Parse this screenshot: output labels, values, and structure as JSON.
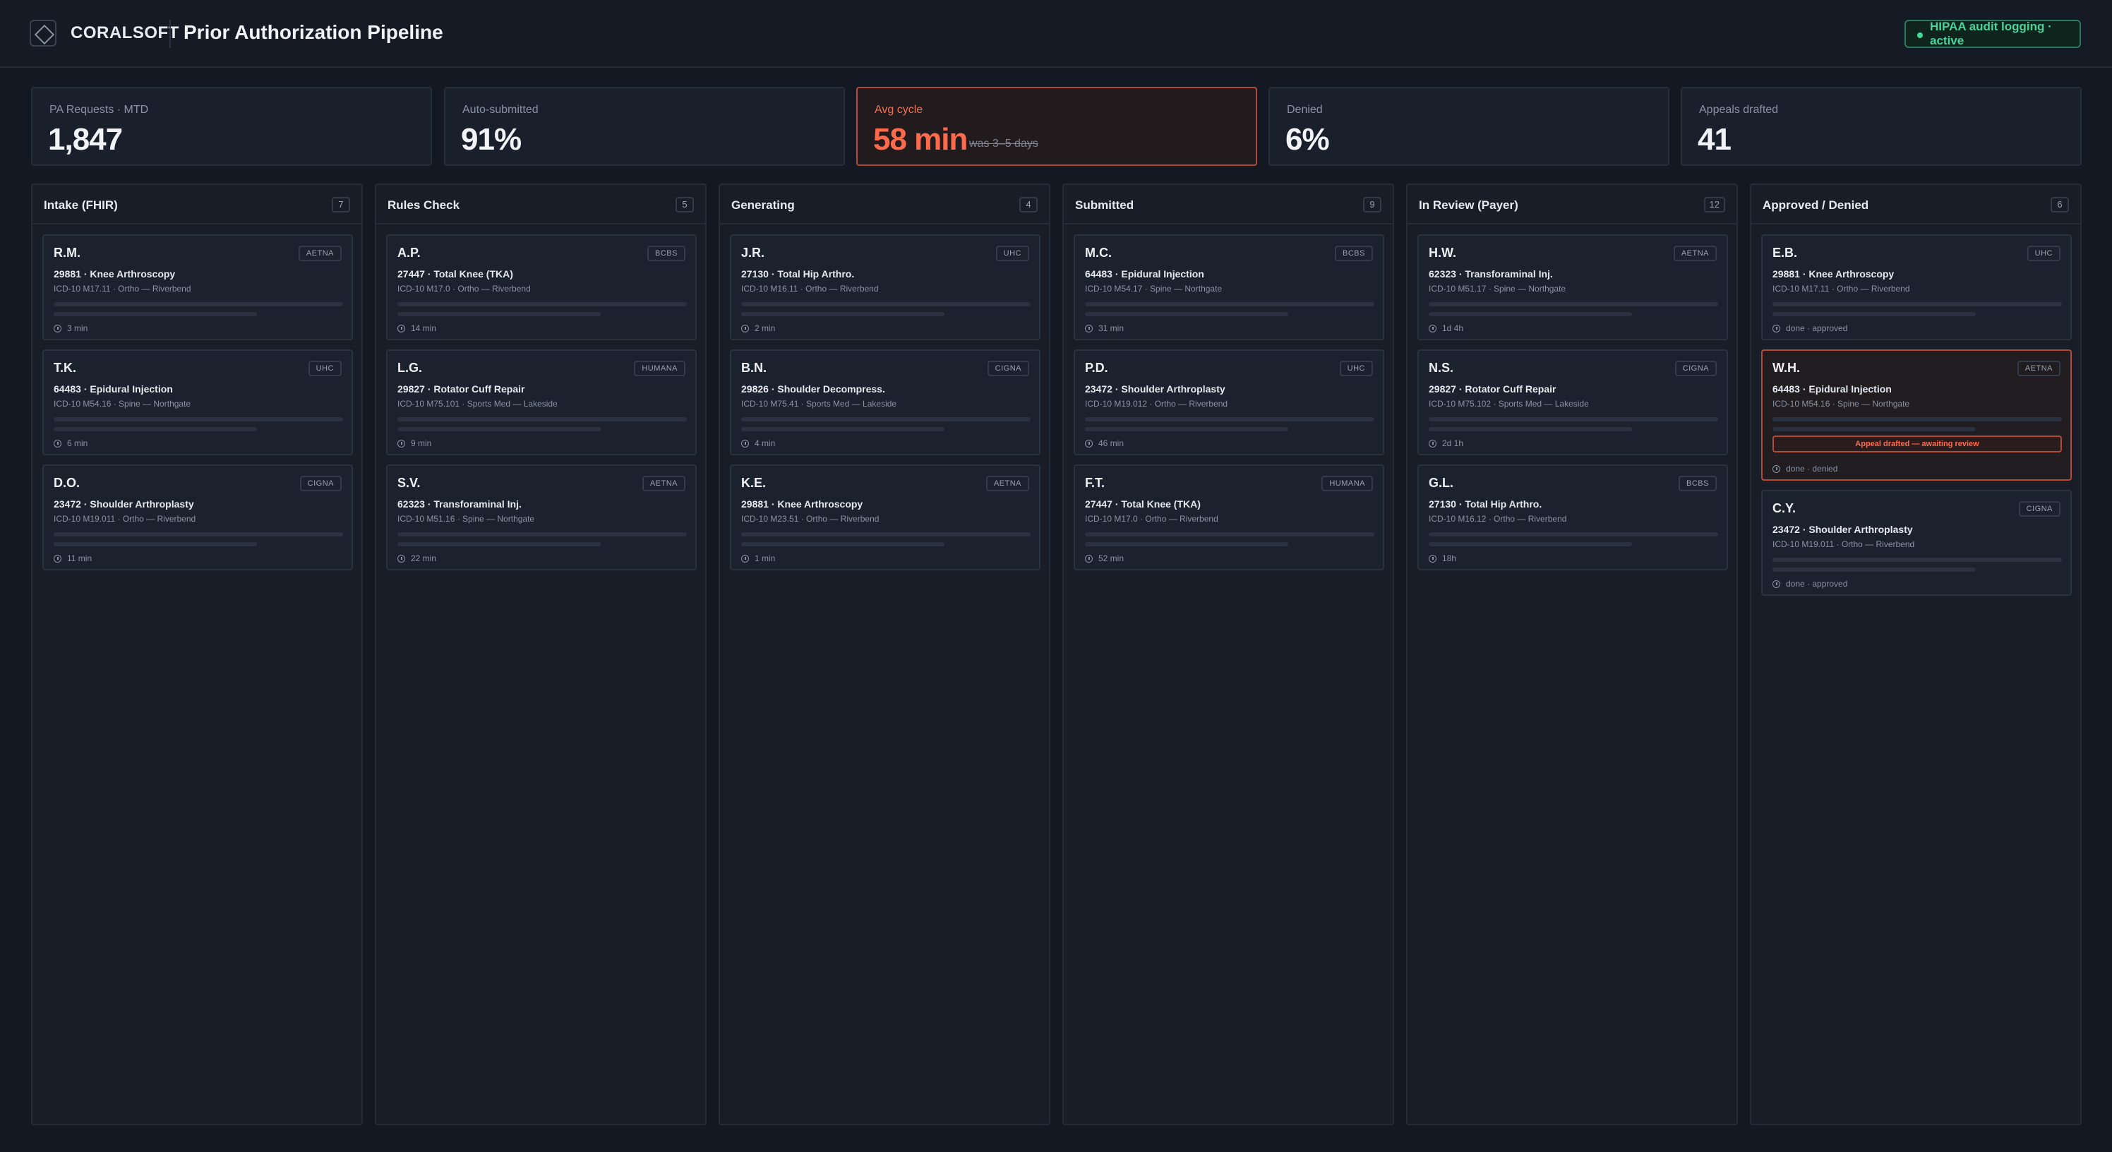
{
  "header": {
    "brand": "CORALSOFT",
    "title": "Prior Authorization Pipeline",
    "audit_status": "HIPAA audit logging · active"
  },
  "kpis": [
    {
      "label": "PA Requests · MTD",
      "value": "1,847"
    },
    {
      "label": "Auto-submitted",
      "value": "91%"
    },
    {
      "label": "Avg cycle",
      "value": "58 min",
      "sub": "was 3–5 days"
    },
    {
      "label": "Denied",
      "value": "6%"
    },
    {
      "label": "Appeals drafted",
      "value": "41"
    }
  ],
  "columns": [
    {
      "title": "Intake (FHIR)",
      "count": "7",
      "cards": [
        {
          "initials": "R.M.",
          "payer": "AETNA",
          "procedure": "29881 · Knee Arthroscopy",
          "dx": "ICD-10 M17.11 · Ortho — Riverbend",
          "time": "3 min"
        },
        {
          "initials": "T.K.",
          "payer": "UHC",
          "procedure": "64483 · Epidural Injection",
          "dx": "ICD-10 M54.16 · Spine — Northgate",
          "time": "6 min"
        },
        {
          "initials": "D.O.",
          "payer": "CIGNA",
          "procedure": "23472 · Shoulder Arthroplasty",
          "dx": "ICD-10 M19.011 · Ortho — Riverbend",
          "time": "11 min"
        }
      ]
    },
    {
      "title": "Rules Check",
      "count": "5",
      "cards": [
        {
          "initials": "A.P.",
          "payer": "BCBS",
          "procedure": "27447 · Total Knee (TKA)",
          "dx": "ICD-10 M17.0 · Ortho — Riverbend",
          "time": "14 min"
        },
        {
          "initials": "L.G.",
          "payer": "HUMANA",
          "procedure": "29827 · Rotator Cuff Repair",
          "dx": "ICD-10 M75.101 · Sports Med — Lakeside",
          "time": "9 min"
        },
        {
          "initials": "S.V.",
          "payer": "AETNA",
          "procedure": "62323 · Transforaminal Inj.",
          "dx": "ICD-10 M51.16 · Spine — Northgate",
          "time": "22 min"
        }
      ]
    },
    {
      "title": "Generating",
      "count": "4",
      "cards": [
        {
          "initials": "J.R.",
          "payer": "UHC",
          "procedure": "27130 · Total Hip Arthro.",
          "dx": "ICD-10 M16.11 · Ortho — Riverbend",
          "time": "2 min"
        },
        {
          "initials": "B.N.",
          "payer": "CIGNA",
          "procedure": "29826 · Shoulder Decompress.",
          "dx": "ICD-10 M75.41 · Sports Med — Lakeside",
          "time": "4 min"
        },
        {
          "initials": "K.E.",
          "payer": "AETNA",
          "procedure": "29881 · Knee Arthroscopy",
          "dx": "ICD-10 M23.51 · Ortho — Riverbend",
          "time": "1 min"
        }
      ]
    },
    {
      "title": "Submitted",
      "count": "9",
      "cards": [
        {
          "initials": "M.C.",
          "payer": "BCBS",
          "procedure": "64483 · Epidural Injection",
          "dx": "ICD-10 M54.17 · Spine — Northgate",
          "time": "31 min"
        },
        {
          "initials": "P.D.",
          "payer": "UHC",
          "procedure": "23472 · Shoulder Arthroplasty",
          "dx": "ICD-10 M19.012 · Ortho — Riverbend",
          "time": "46 min"
        },
        {
          "initials": "F.T.",
          "payer": "HUMANA",
          "procedure": "27447 · Total Knee (TKA)",
          "dx": "ICD-10 M17.0 · Ortho — Riverbend",
          "time": "52 min"
        }
      ]
    },
    {
      "title": "In Review (Payer)",
      "count": "12",
      "cards": [
        {
          "initials": "H.W.",
          "payer": "AETNA",
          "procedure": "62323 · Transforaminal Inj.",
          "dx": "ICD-10 M51.17 · Spine — Northgate",
          "time": "1d 4h"
        },
        {
          "initials": "N.S.",
          "payer": "CIGNA",
          "procedure": "29827 · Rotator Cuff Repair",
          "dx": "ICD-10 M75.102 · Sports Med — Lakeside",
          "time": "2d 1h"
        },
        {
          "initials": "G.L.",
          "payer": "BCBS",
          "procedure": "27130 · Total Hip Arthro.",
          "dx": "ICD-10 M16.12 · Ortho — Riverbend",
          "time": "18h"
        }
      ]
    },
    {
      "title": "Approved / Denied",
      "count": "6",
      "cards": [
        {
          "initials": "E.B.",
          "payer": "UHC",
          "procedure": "29881 · Knee Arthroscopy",
          "dx": "ICD-10 M17.11 · Ortho — Riverbend",
          "time": "done · approved"
        },
        {
          "initials": "W.H.",
          "payer": "AETNA",
          "procedure": "64483 · Epidural Injection",
          "dx": "ICD-10 M54.16 · Spine — Northgate",
          "time": "done · denied",
          "banner": "Appeal drafted — awaiting review"
        },
        {
          "initials": "C.Y.",
          "payer": "CIGNA",
          "procedure": "23472 · Shoulder Arthroplasty",
          "dx": "ICD-10 M19.011 · Ortho — Riverbend",
          "time": "done · approved"
        }
      ]
    }
  ],
  "colors": {
    "background": "#131822",
    "accent_alert": "#ff6a4d",
    "audit_green": "#49d39a"
  },
  "icons": [
    "logo-icon",
    "status-dot-icon",
    "clock-icon"
  ]
}
